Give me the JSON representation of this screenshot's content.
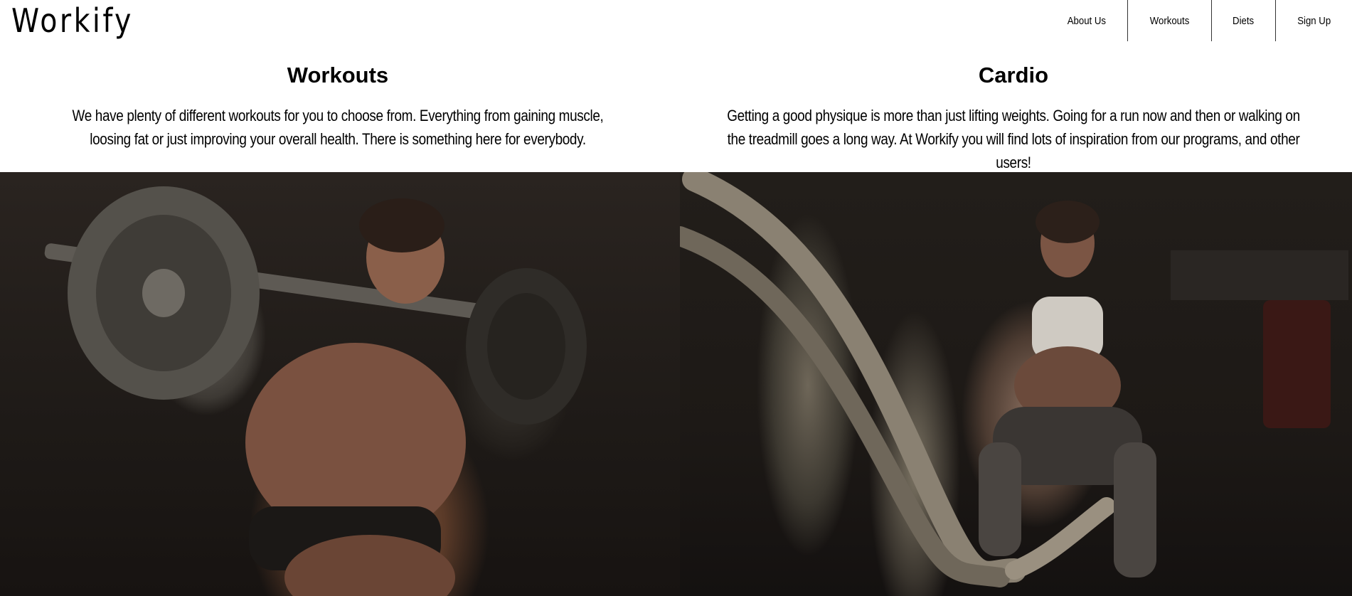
{
  "header": {
    "logo": "Workify",
    "nav": [
      {
        "label": "About Us"
      },
      {
        "label": "Workouts"
      },
      {
        "label": "Diets"
      },
      {
        "label": "Sign Up"
      }
    ]
  },
  "sections": [
    {
      "title": "Workouts",
      "text": "We have plenty of different workouts for you to choose from. Everything from gaining muscle, loosing fat or just improving your overall health. There is something here for everybody."
    },
    {
      "title": "Cardio",
      "text": "Getting a good physique is more than just lifting weights. Going for a run now and then or walking on the treadmill goes a long way. At Workify you will find lots of inspiration from our programs, and other users!"
    }
  ],
  "images": [
    {
      "icon": "weightlifter-squat-photo"
    },
    {
      "icon": "battle-ropes-photo"
    }
  ]
}
